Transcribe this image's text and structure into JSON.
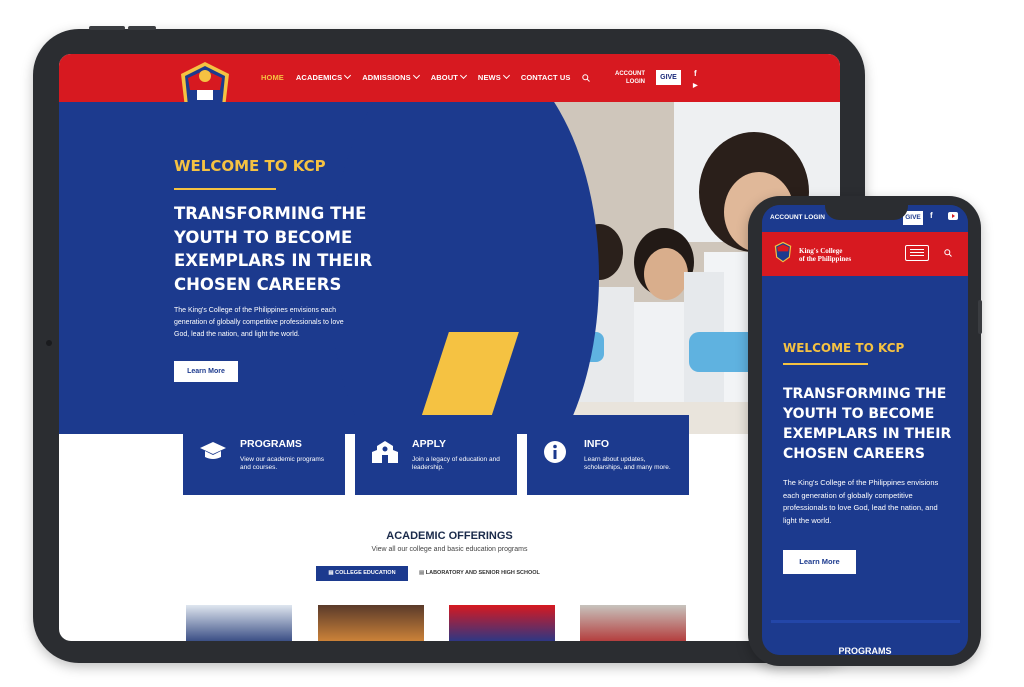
{
  "tablet": {
    "nav": {
      "items": [
        {
          "label": "HOME",
          "active": true,
          "dropdown": false
        },
        {
          "label": "ACADEMICS",
          "active": false,
          "dropdown": true
        },
        {
          "label": "ADMISSIONS",
          "active": false,
          "dropdown": true
        },
        {
          "label": "ABOUT",
          "active": false,
          "dropdown": true
        },
        {
          "label": "NEWS",
          "active": false,
          "dropdown": true
        },
        {
          "label": "CONTACT US",
          "active": false,
          "dropdown": false
        }
      ],
      "account_line1": "ACCOUNT",
      "account_line2": "LOGIN",
      "give_label": "GIVE",
      "facebook_glyph": "f",
      "youtube_glyph": "▶"
    },
    "hero": {
      "welcome": "WELCOME TO KCP",
      "title_lines": [
        "TRANSFORMING THE",
        "YOUTH TO BECOME",
        "EXEMPLARS IN THEIR",
        "CHOSEN CAREERS"
      ],
      "description": "The King's College of the Philippines envisions each generation of globally competitive professionals to love God, lead the nation, and light the world.",
      "button": "Learn More"
    },
    "cards": [
      {
        "title": "PROGRAMS",
        "desc": "View our academic programs and courses.",
        "icon": "graduation-cap-icon",
        "glyph": "🎓"
      },
      {
        "title": "APPLY",
        "desc": "Join a legacy of education and leadership.",
        "icon": "school-building-icon",
        "glyph": "🏫"
      },
      {
        "title": "INFO",
        "desc": "Learn about updates, scholarships, and many more.",
        "icon": "info-icon",
        "glyph": "ℹ"
      }
    ],
    "offerings": {
      "title": "ACADEMIC OFFERINGS",
      "subtitle": "View all our college and basic education programs",
      "tab_active": "COLLEGE EDUCATION",
      "tab_inactive": "LABORATORY AND SENIOR HIGH SCHOOL"
    }
  },
  "phone": {
    "account": "ACCOUNT LOGIN",
    "give": "GIVE",
    "facebook_glyph": "f",
    "brand_line1": "King's College",
    "brand_line2": "of the Philippines",
    "welcome": "WELCOME TO KCP",
    "title_lines": [
      "TRANSFORMING THE",
      "YOUTH TO BECOME",
      "EXEMPLARS IN THEIR",
      "CHOSEN CAREERS"
    ],
    "description": "The King's College of the Philippines envisions each generation of globally competitive professionals to love God, lead the nation, and light the world.",
    "button": "Learn More",
    "card_title": "PROGRAMS"
  },
  "colors": {
    "brand_red": "#d71920",
    "brand_blue": "#1c3a8e",
    "accent_gold": "#f5c242"
  }
}
